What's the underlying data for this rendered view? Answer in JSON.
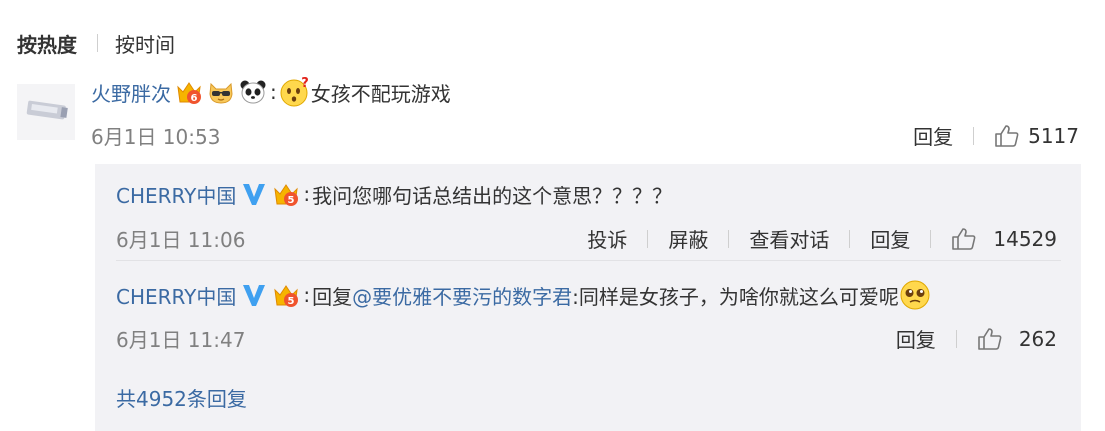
{
  "sort": {
    "hot_label": "按热度",
    "time_label": "按时间"
  },
  "main": {
    "username": "火野胖次",
    "text": "女孩不配玩游戏",
    "date": "6月1日 10:53",
    "reply_label": "回复",
    "likes": "5117"
  },
  "replies": [
    {
      "username": "CHERRY中国",
      "text": "我问您哪句话总结出的这个意思？？？？",
      "date": "6月1日 11:06",
      "actions": [
        "投诉",
        "屏蔽",
        "查看对话",
        "回复"
      ],
      "likes": "14529"
    },
    {
      "username": "CHERRY中国",
      "reply_prefix": "回复",
      "mention": "@要优雅不要污的数字君",
      "text": ":同样是女孩子，为啥你就这么可爱呢",
      "date": "6月1日 11:47",
      "reply_label": "回复",
      "likes": "262"
    }
  ],
  "total_replies": "共4952条回复",
  "colors": {
    "link": "#3b6aa3",
    "meta": "#808080",
    "reply_bg": "#f2f2f5"
  },
  "icons": [
    "crown-icon",
    "sunglasses-cat-icon",
    "panda-icon",
    "confused-face-icon",
    "verified-v-icon",
    "thumbs-up-icon",
    "teary-face-icon"
  ]
}
